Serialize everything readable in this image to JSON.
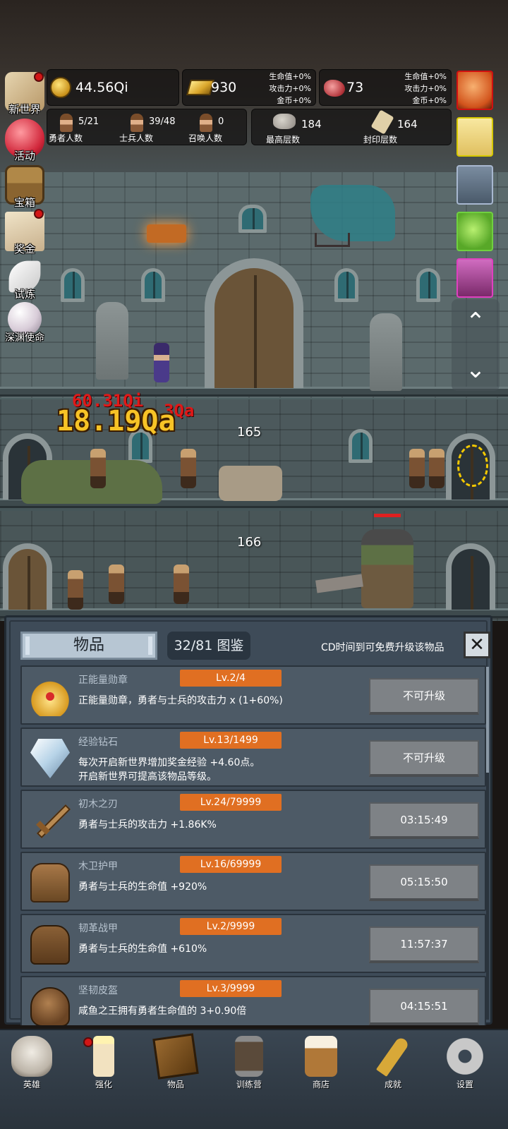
{
  "resources": {
    "coins": "44.56Qi",
    "gold": "930",
    "gems": "73",
    "gold_bonus": [
      "生命值+0%",
      "攻击力+0%",
      "金币+0%"
    ],
    "gem_bonus": [
      "生命值+0%",
      "攻击力+0%",
      "金币+0%"
    ]
  },
  "stats": {
    "hero_count": {
      "value": "5/21",
      "label": "勇者人数"
    },
    "soldier_count": {
      "value": "39/48",
      "label": "士兵人数"
    },
    "summon_count": {
      "value": "0",
      "label": "召唤人数"
    },
    "highest_floor": {
      "value": "184",
      "label": "最高层数"
    },
    "sealed_floor": {
      "value": "164",
      "label": "封印层数"
    }
  },
  "left_menu": [
    {
      "label": "新世界",
      "icon": "map-scroll-icon",
      "badge": true
    },
    {
      "label": "活动",
      "icon": "heart-icon",
      "badge": false
    },
    {
      "label": "宝箱",
      "icon": "treasure-chest-icon",
      "badge": false
    },
    {
      "label": "奖金",
      "icon": "envelope-icon",
      "badge": true
    },
    {
      "label": "试炼",
      "icon": "feather-icon",
      "badge": false
    },
    {
      "label": "深渊使命",
      "icon": "pearl-icon",
      "badge": false
    }
  ],
  "scene": {
    "floor_a": "165",
    "floor_b": "166",
    "damage_red": "60.31Qi",
    "damage_red_2": "3Qa",
    "damage_yellow": "18.19Qa"
  },
  "panel": {
    "tab_label": "物品",
    "collection": "32/81 图鉴",
    "cd_hint": "CD时间到可免费升级该物品",
    "close_label": "✕",
    "items": [
      {
        "name": "正能量勋章",
        "level": "Lv.2/4",
        "desc": "正能量勋章，勇者与士兵的攻击力 x (1+60%)",
        "desc2": "",
        "button": "不可升级",
        "icon": "crown-medal-icon"
      },
      {
        "name": "经验钻石",
        "level": "Lv.13/1499",
        "desc": "每次开启新世界增加奖金经验 +4.60点。",
        "desc2": "开启新世界可提高该物品等级。",
        "button": "不可升级",
        "icon": "diamond-icon"
      },
      {
        "name": "初木之刃",
        "level": "Lv.24/79999",
        "desc": "勇者与士兵的攻击力 +1.86K%",
        "desc2": "",
        "button": "03:15:49",
        "icon": "wooden-sword-icon"
      },
      {
        "name": "木卫护甲",
        "level": "Lv.16/69999",
        "desc": "勇者与士兵的生命值 +920%",
        "desc2": "",
        "button": "05:15:50",
        "icon": "wooden-armor-icon"
      },
      {
        "name": "韧革战甲",
        "level": "Lv.2/9999",
        "desc": "勇者与士兵的生命值 +610%",
        "desc2": "",
        "button": "11:57:37",
        "icon": "leather-armor-icon"
      },
      {
        "name": "坚韧皮盔",
        "level": "Lv.3/9999",
        "desc": "咸鱼之王拥有勇者生命值的 3+0.90倍",
        "desc2": "",
        "button": "04:15:51",
        "icon": "leather-helmet-icon"
      }
    ]
  },
  "nav": [
    {
      "label": "英雄",
      "icon": "skull-icon",
      "badge": false
    },
    {
      "label": "强化",
      "icon": "candle-icon",
      "badge": true
    },
    {
      "label": "物品",
      "icon": "book-icon",
      "badge": false
    },
    {
      "label": "训练营",
      "icon": "lantern-icon",
      "badge": false
    },
    {
      "label": "商店",
      "icon": "beer-mug-icon",
      "badge": false
    },
    {
      "label": "成就",
      "icon": "key-icon",
      "badge": false
    },
    {
      "label": "设置",
      "icon": "gear-icon",
      "badge": false
    }
  ],
  "colors": {
    "level_badge": "#e06f22",
    "panel_bg": "#3e4b58",
    "row_bg": "#4d5a66",
    "button_gray": "#7e8286"
  }
}
